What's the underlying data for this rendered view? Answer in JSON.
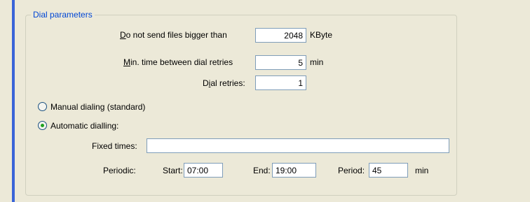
{
  "group": {
    "title": "Dial parameters"
  },
  "max_file_size": {
    "label_u": "D",
    "label_rest": "o not send files bigger than",
    "value": "2048",
    "unit": "KByte"
  },
  "min_retry_time": {
    "label_u": "M",
    "label_rest": "in. time between dial retries",
    "value": "5",
    "unit": "min"
  },
  "dial_retries": {
    "label_pre": "D",
    "label_u": "i",
    "label_post": "al retries:",
    "value": "1"
  },
  "dial_mode": {
    "manual_label": "Manual dialing (standard)",
    "automatic_label": "Automatic dialling:",
    "selected": "automatic"
  },
  "fixed_times": {
    "label": "Fixed times:",
    "value": ""
  },
  "periodic": {
    "label": "Periodic:",
    "start_label": "Start:",
    "start_value": "07:00",
    "end_label": "End:",
    "end_value": "19:00",
    "period_label": "Period:",
    "period_value": "45",
    "period_unit": "min"
  }
}
